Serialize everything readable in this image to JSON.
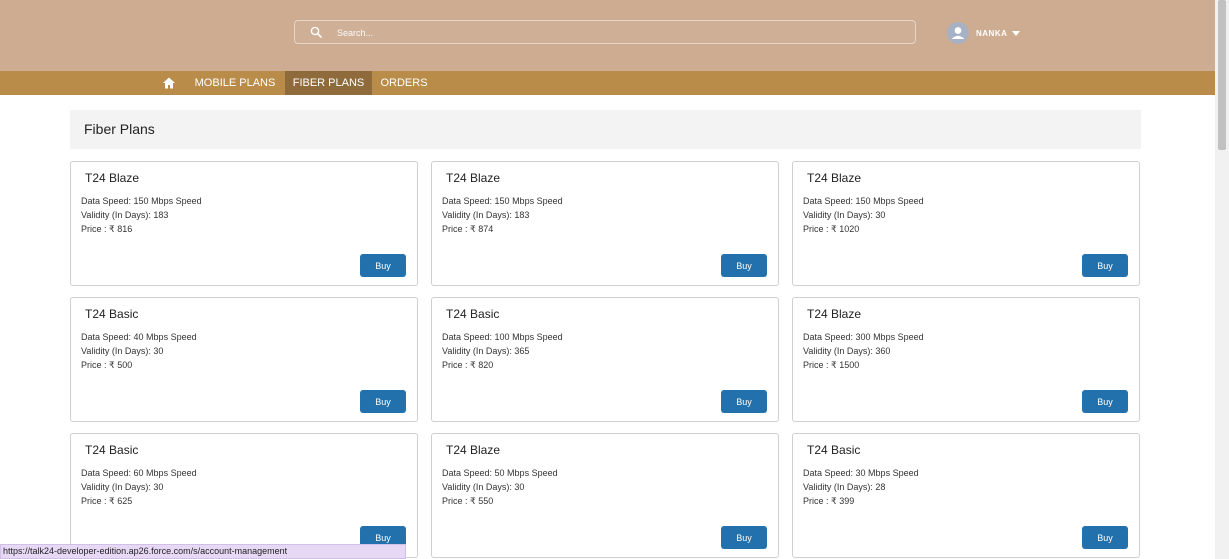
{
  "header": {
    "search_placeholder": "Search...",
    "user_name": "NANKA"
  },
  "nav": {
    "items": [
      {
        "label": "MOBILE PLANS"
      },
      {
        "label": "FIBER PLANS"
      },
      {
        "label": "ORDERS"
      }
    ]
  },
  "section": {
    "title": "Fiber Plans"
  },
  "labels": {
    "speed_prefix": "Data Speed: ",
    "validity_prefix": "Validity (In Days): ",
    "price_prefix": "Price : ₹ ",
    "buy": "Buy"
  },
  "plans": [
    {
      "name": "T24 Blaze",
      "speed": "150 Mbps Speed",
      "validity": "183",
      "price": "816"
    },
    {
      "name": "T24 Blaze",
      "speed": "150 Mbps Speed",
      "validity": "183",
      "price": "874"
    },
    {
      "name": "T24 Blaze",
      "speed": "150 Mbps Speed",
      "validity": "30",
      "price": "1020"
    },
    {
      "name": "T24 Basic",
      "speed": "40 Mbps Speed",
      "validity": "30",
      "price": "500"
    },
    {
      "name": "T24 Basic",
      "speed": "100 Mbps Speed",
      "validity": "365",
      "price": "820"
    },
    {
      "name": "T24 Blaze",
      "speed": "300 Mbps Speed",
      "validity": "360",
      "price": "1500"
    },
    {
      "name": "T24 Basic",
      "speed": "60 Mbps Speed",
      "validity": "30",
      "price": "625"
    },
    {
      "name": "T24 Blaze",
      "speed": "50 Mbps Speed",
      "validity": "30",
      "price": "550"
    },
    {
      "name": "T24 Basic",
      "speed": "30 Mbps Speed",
      "validity": "28",
      "price": "399"
    }
  ],
  "status_bar": {
    "url": "https://talk24-developer-edition.ap26.force.com/s/account-management"
  }
}
